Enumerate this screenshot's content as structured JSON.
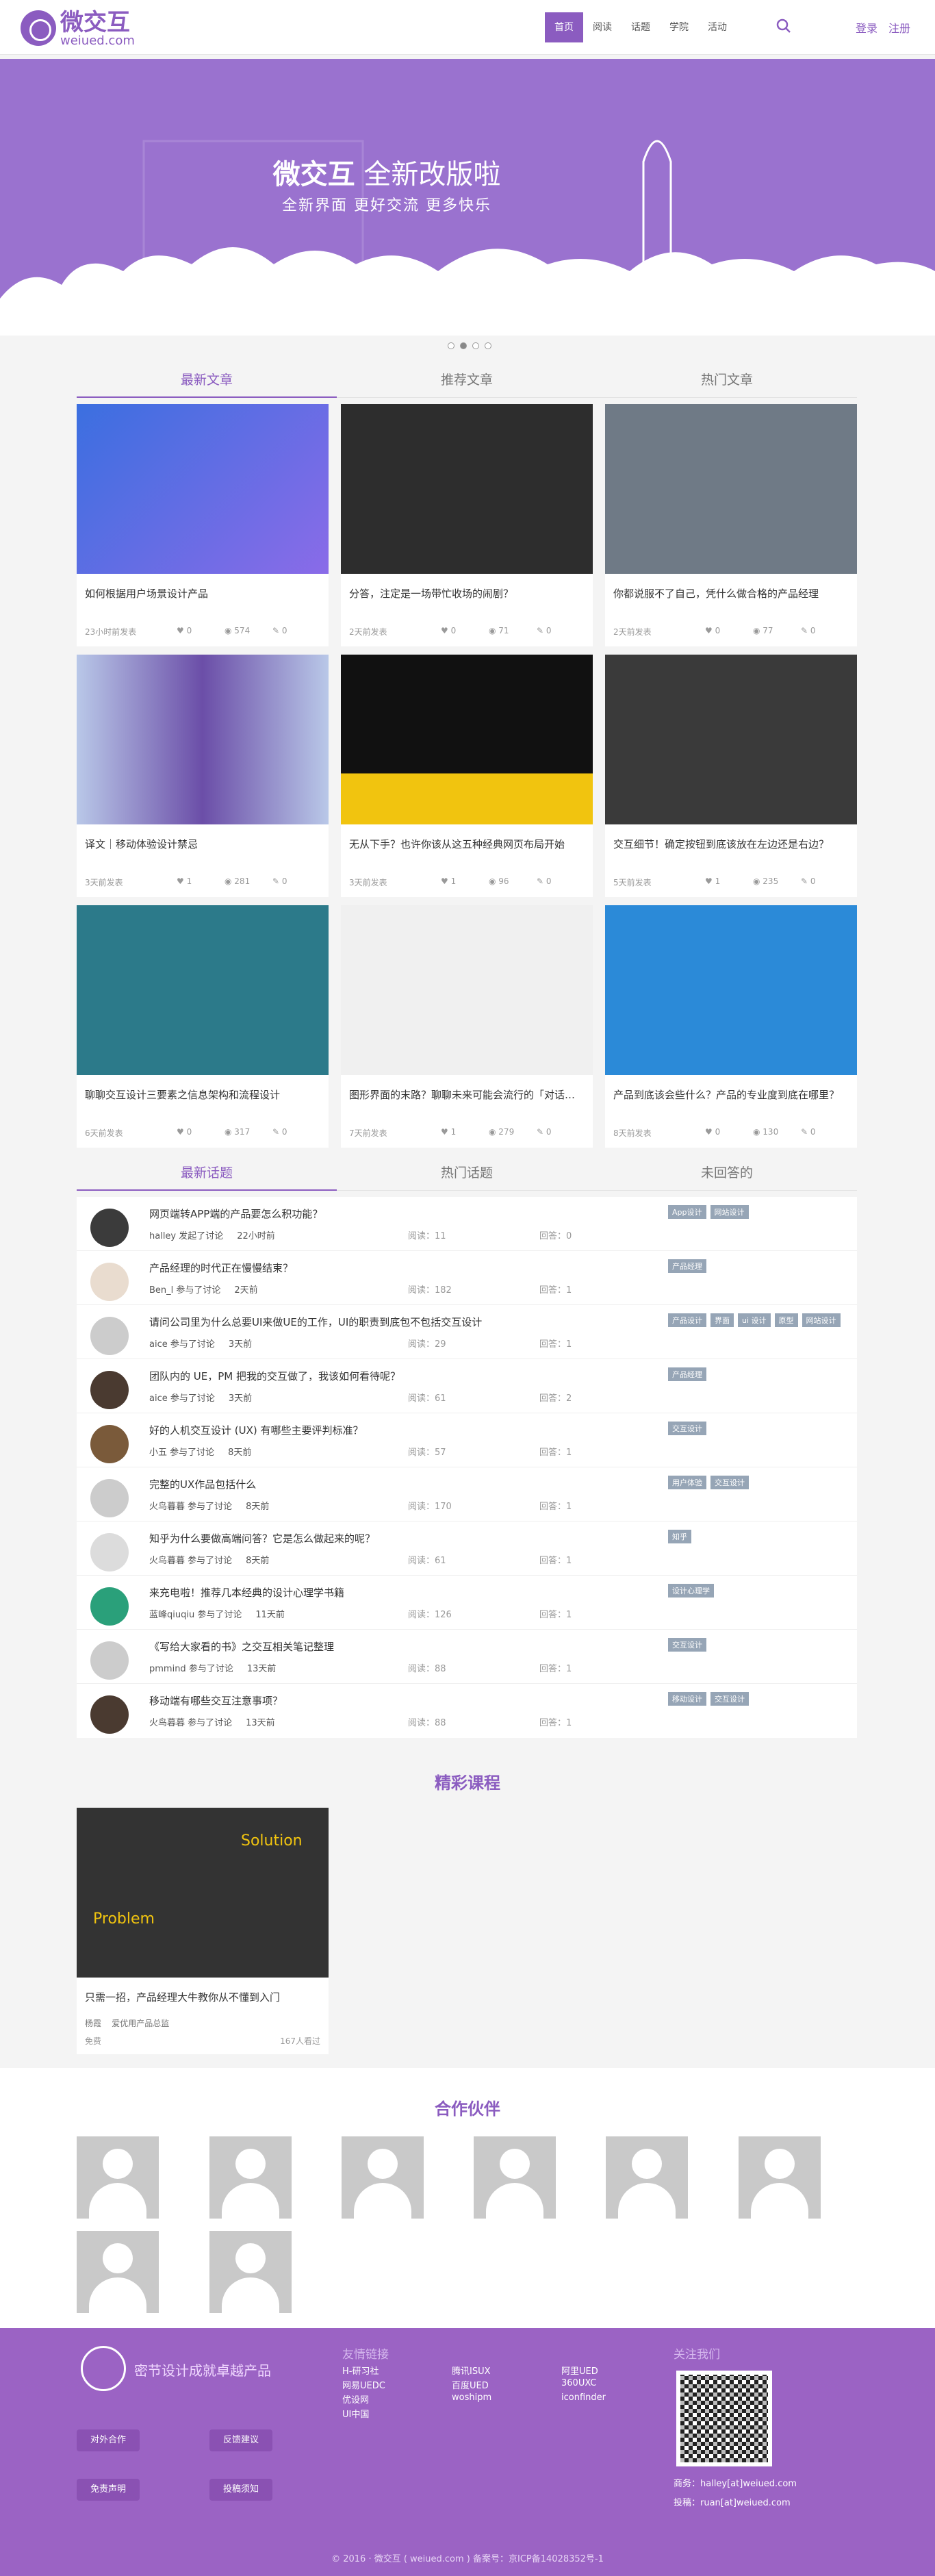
{
  "header": {
    "logo_cn": "微交互",
    "logo_en": "weiued.com",
    "nav": [
      "首页",
      "阅读",
      "话题",
      "学院",
      "活动"
    ],
    "login": "登录",
    "register": "注册"
  },
  "banner": {
    "title_bold": "微交互",
    "title_rest": " 全新改版啦",
    "subtitle": "全新界面  更好交流  更多快乐"
  },
  "article_tabs": [
    "最新文章",
    "推荐文章",
    "热门文章"
  ],
  "articles": [
    {
      "title": "如何根据用户场景设计产品",
      "time": "23小时前发表",
      "likes": "0",
      "views": "574",
      "comments": "0"
    },
    {
      "title": "分答，注定是一场带忙收场的闹剧？",
      "time": "2天前发表",
      "likes": "0",
      "views": "71",
      "comments": "0"
    },
    {
      "title": "你都说服不了自己，凭什么做合格的产品经理",
      "time": "2天前发表",
      "likes": "0",
      "views": "77",
      "comments": "0"
    },
    {
      "title": "译文｜移动体验设计禁忌",
      "time": "3天前发表",
      "likes": "1",
      "views": "281",
      "comments": "0"
    },
    {
      "title": "无从下手？也许你该从这五种经典网页布局开始",
      "time": "3天前发表",
      "likes": "1",
      "views": "96",
      "comments": "0"
    },
    {
      "title": "交互细节！确定按钮到底该放在左边还是右边？",
      "time": "5天前发表",
      "likes": "1",
      "views": "235",
      "comments": "0"
    },
    {
      "title": "聊聊交互设计三要素之信息架构和流程设计",
      "time": "6天前发表",
      "likes": "0",
      "views": "317",
      "comments": "0"
    },
    {
      "title": "图形界面的末路？聊聊未来可能会流行的「对话式界面」",
      "time": "7天前发表",
      "likes": "1",
      "views": "279",
      "comments": "0"
    },
    {
      "title": "产品到底该会些什么？产品的专业度到底在哪里？",
      "time": "8天前发表",
      "likes": "0",
      "views": "130",
      "comments": "0"
    }
  ],
  "topic_tabs": [
    "最新话题",
    "热门话题",
    "未回答的"
  ],
  "topics": [
    {
      "title": "网页端转APP端的产品要怎么积功能？",
      "by": "halley 发起了讨论",
      "time": "22小时前",
      "read": "阅读：11",
      "reply": "回答：0",
      "tags": [
        "App设计",
        "网站设计"
      ]
    },
    {
      "title": "产品经理的时代正在慢慢结束？",
      "by": "Ben_l 参与了讨论",
      "time": "2天前",
      "read": "阅读：182",
      "reply": "回答：1",
      "tags": [
        "产品经理"
      ]
    },
    {
      "title": "请问公司里为什么总要UI来做UE的工作，UI的职责到底包不包括交互设计",
      "by": "aice 参与了讨论",
      "time": "3天前",
      "read": "阅读：29",
      "reply": "回答：1",
      "tags": [
        "产品设计",
        "界面",
        "ui 设计",
        "原型",
        "网站设计"
      ]
    },
    {
      "title": "团队内的 UE，PM 把我的交互做了，我该如何看待呢？",
      "by": "aice 参与了讨论",
      "time": "3天前",
      "read": "阅读：61",
      "reply": "回答：2",
      "tags": [
        "产品经理"
      ]
    },
    {
      "title": "好的人机交互设计 (UX) 有哪些主要评判标准？",
      "by": "小五 参与了讨论",
      "time": "8天前",
      "read": "阅读：57",
      "reply": "回答：1",
      "tags": [
        "交互设计"
      ]
    },
    {
      "title": "完整的UX作品包括什么",
      "by": "火鸟暮暮 参与了讨论",
      "time": "8天前",
      "read": "阅读：170",
      "reply": "回答：1",
      "tags": [
        "用户体验",
        "交互设计"
      ]
    },
    {
      "title": "知乎为什么要做高端问答？它是怎么做起来的呢？",
      "by": "火鸟暮暮 参与了讨论",
      "time": "8天前",
      "read": "阅读：61",
      "reply": "回答：1",
      "tags": [
        "知乎"
      ]
    },
    {
      "title": "来充电啦！推荐几本经典的设计心理学书籍",
      "by": "蓝峰qiuqiu 参与了讨论",
      "time": "11天前",
      "read": "阅读：126",
      "reply": "回答：1",
      "tags": [
        "设计心理学"
      ]
    },
    {
      "title": "《写给大家看的书》之交互相关笔记整理",
      "by": "pmmind 参与了讨论",
      "time": "13天前",
      "read": "阅读：88",
      "reply": "回答：1",
      "tags": [
        "交互设计"
      ]
    },
    {
      "title": "移动端有哪些交互注意事项？",
      "by": "火鸟暮暮 参与了讨论",
      "time": "13天前",
      "read": "阅读：88",
      "reply": "回答：1",
      "tags": [
        "移动设计",
        "交互设计"
      ]
    }
  ],
  "courses_title": "精彩课程",
  "course": {
    "title": "只需一招，产品经理大牛教你从不懂到入门",
    "teacher": "杨霞",
    "org": "爱优用产品总监",
    "price": "免费",
    "count": "167人看过",
    "img_left": "Problem",
    "img_right": "Solution"
  },
  "partners_title": "合作伙伴",
  "footer": {
    "slogan": "密节设计成就卓越产品",
    "buttons": [
      "对外合作",
      "反馈建议",
      "免责声明",
      "投稿须知"
    ],
    "links_title": "友情链接",
    "links": [
      "H-研习社",
      "腾讯ISUX",
      "阿里UED",
      "网易UEDC",
      "百度UED",
      "360UXC",
      "优设网",
      "woshipm",
      "iconfinder",
      "UI中国"
    ],
    "contact_title": "关注我们",
    "email1": "商务：halley[at]weiued.com",
    "email2": "投稿：ruan[at]weiued.com",
    "copyright": "© 2016 · 微交互 ( weiued.com ) 备案号：京ICP备14028352号-1"
  },
  "colors": {
    "brand": "#8b5cc0",
    "footer": "#9b63c4"
  }
}
